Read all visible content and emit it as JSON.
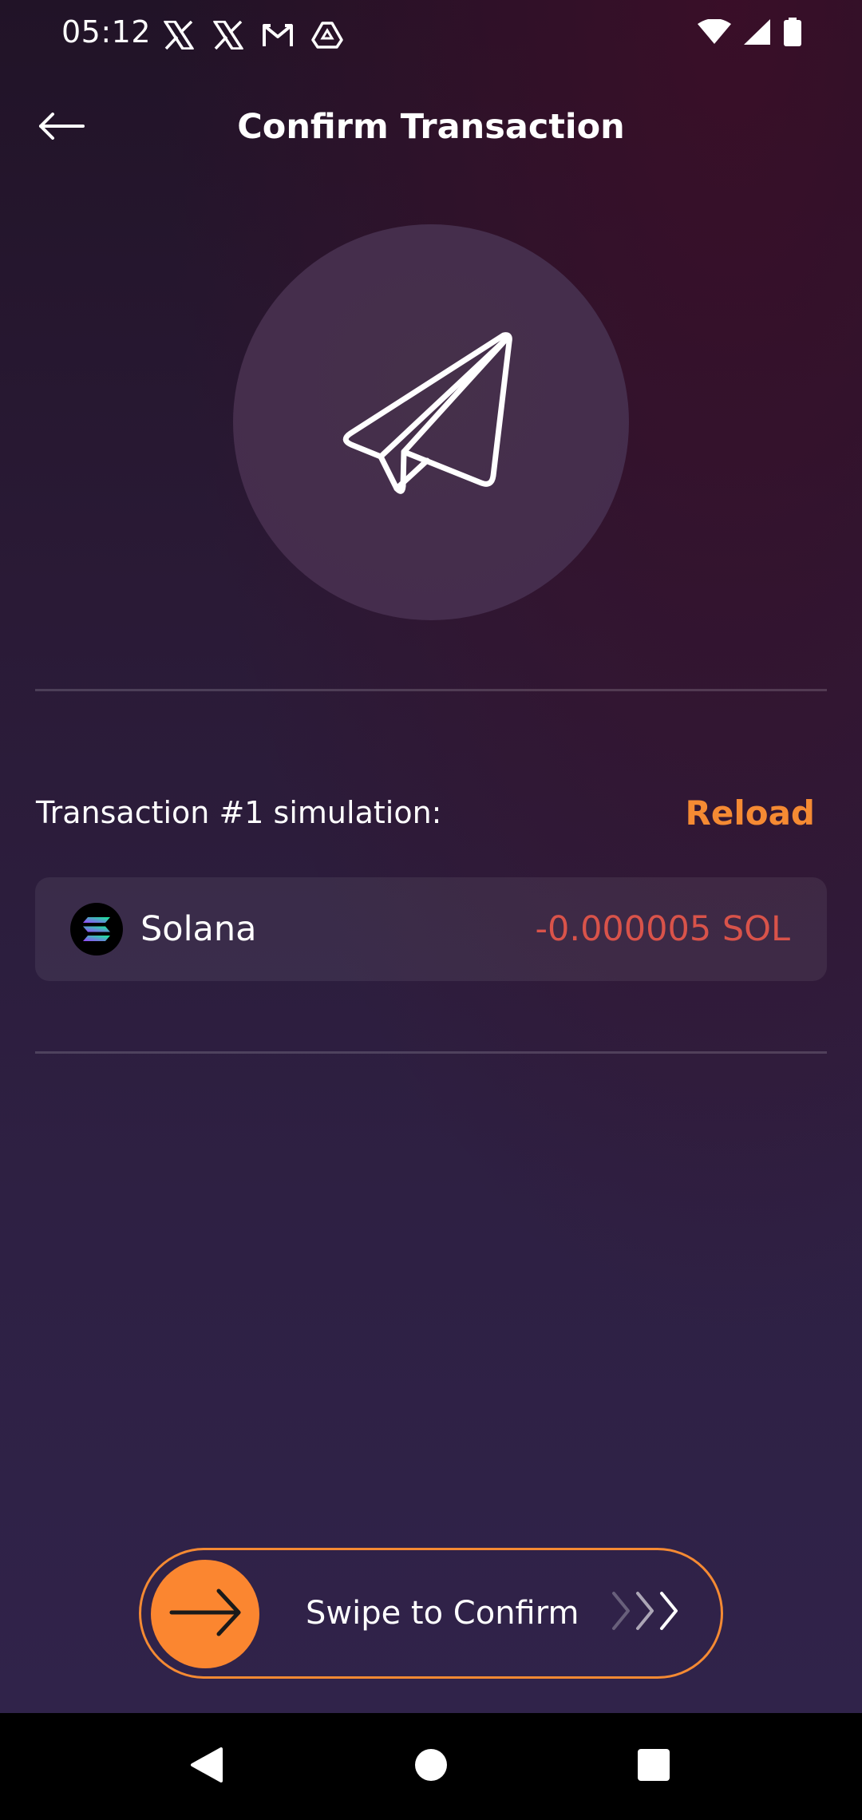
{
  "status_bar": {
    "time": "05:12",
    "left_icons": [
      "x-icon",
      "x-icon",
      "gmail-icon",
      "drive-icon"
    ],
    "right_icons": [
      "wifi-icon",
      "signal-icon",
      "battery-icon"
    ]
  },
  "header": {
    "title": "Confirm Transaction",
    "back_icon": "arrow-left-icon"
  },
  "hero": {
    "icon": "paper-plane-icon"
  },
  "simulation": {
    "label": "Transaction #1 simulation:",
    "reload_label": "Reload",
    "token": {
      "name": "Solana",
      "amount": "-0.000005 SOL",
      "logo_icon": "solana-logo-icon"
    }
  },
  "swipe": {
    "label": "Swipe to Confirm",
    "handle_icon": "arrow-right-icon"
  },
  "nav_bar": {
    "buttons": [
      "back-triangle-icon",
      "home-circle-icon",
      "recents-square-icon"
    ]
  },
  "colors": {
    "accent": "#f58a33",
    "negative_amount": "#d9534a",
    "background_top": "#211327",
    "background_bottom": "#30234a"
  }
}
